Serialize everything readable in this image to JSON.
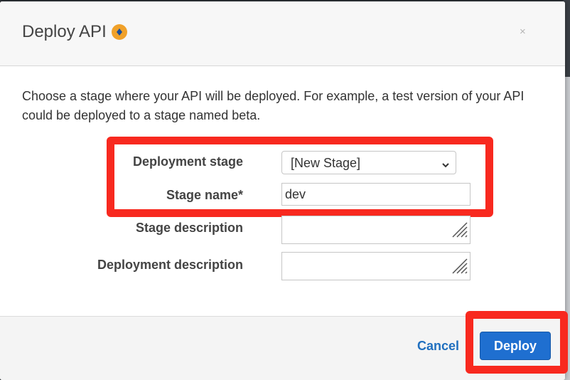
{
  "dialog": {
    "title": "Deploy API",
    "close_glyph": "×",
    "intro": "Choose a stage where your API will be deployed. For example, a test version of your API could be deployed to a stage named beta."
  },
  "form": {
    "deployment_stage_label": "Deployment stage",
    "deployment_stage_value": "[New Stage]",
    "stage_name_label": "Stage name*",
    "stage_name_value": "dev",
    "stage_description_label": "Stage description",
    "deployment_description_label": "Deployment description"
  },
  "footer": {
    "cancel_label": "Cancel",
    "deploy_label": "Deploy"
  },
  "colors": {
    "highlight": "#f8291f",
    "primary_button": "#1f6fd0",
    "link": "#1f6fbf",
    "info_icon": "#f0a12a"
  },
  "icons": {
    "info": "info-badge-icon",
    "close": "close-icon",
    "select_arrow": "chevron-down-icon",
    "resize": "resize-grip-icon"
  }
}
